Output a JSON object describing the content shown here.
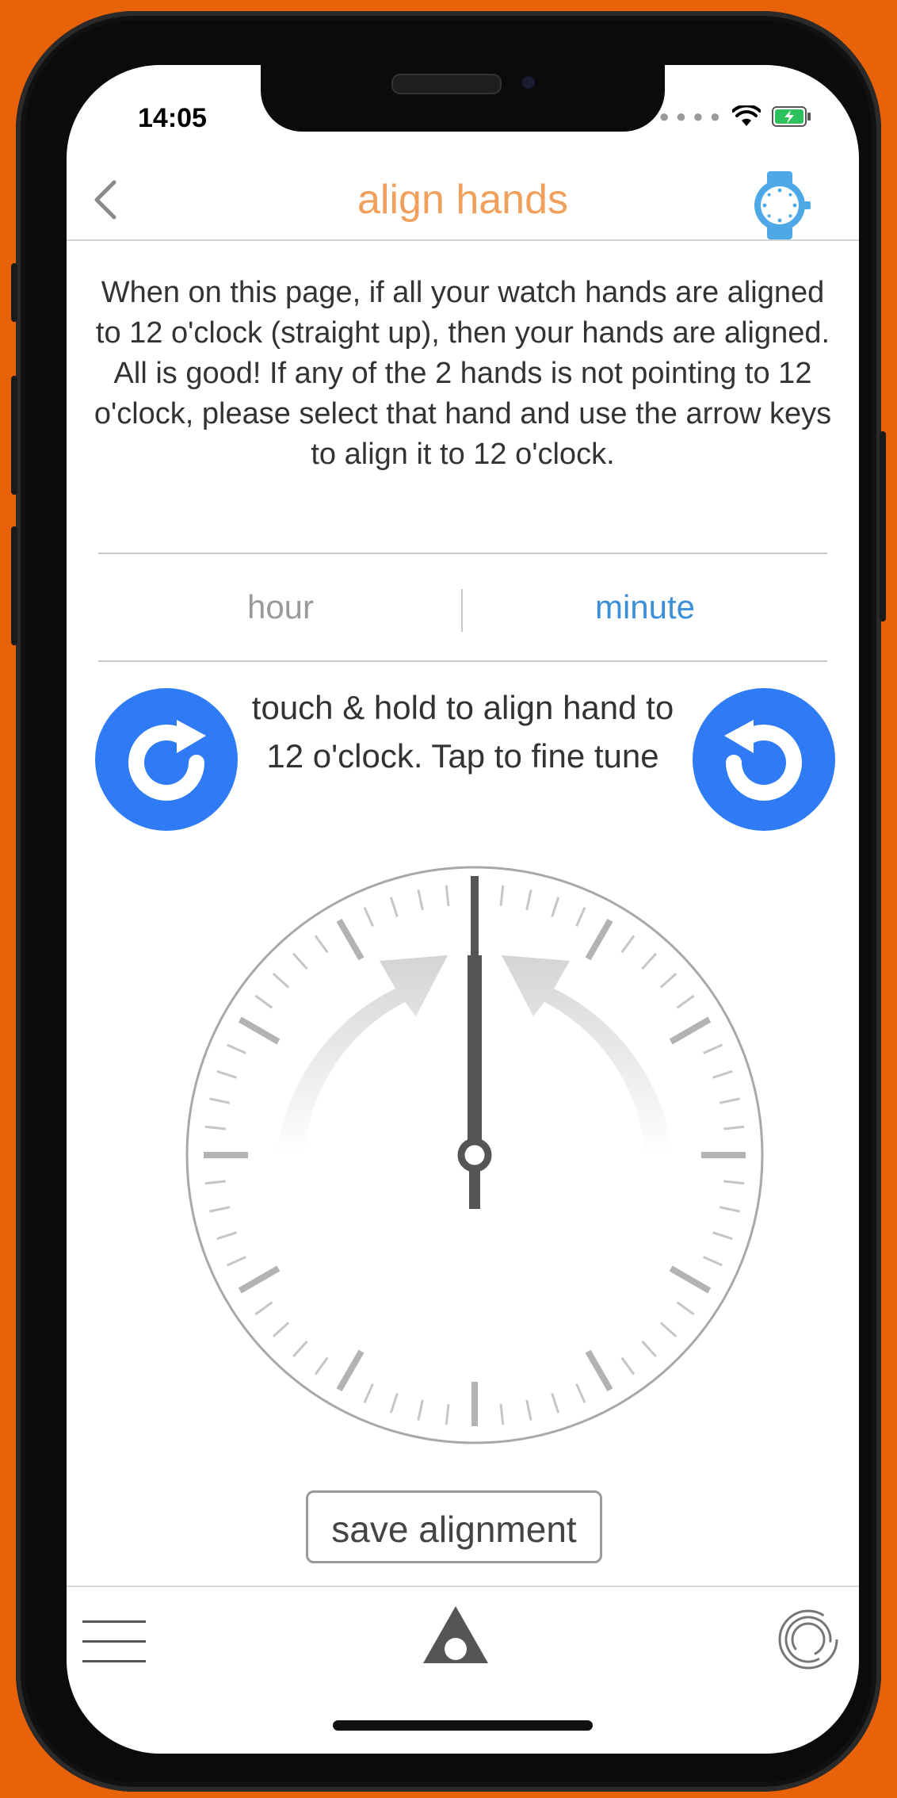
{
  "status_bar": {
    "time": "14:05",
    "signal_icon": "signal-dots-icon",
    "wifi_icon": "wifi-icon",
    "battery_icon": "battery-charging-icon"
  },
  "nav": {
    "title": "align hands",
    "back_icon": "chevron-left-icon",
    "watch_icon": "watch-icon"
  },
  "instructions": "When on this page, if all your watch hands are aligned to 12 o'clock (straight up), then your hands are aligned. All is good! If any of the 2 hands is not pointing to 12 o'clock, please select that hand and use the arrow keys to align it to 12 o'clock.",
  "segmented": {
    "options": [
      "hour",
      "minute"
    ],
    "selected": "minute"
  },
  "hint": "touch & hold to align hand to 12 o'clock. Tap to fine tune",
  "rotate_buttons": {
    "left_icon": "rotate-clockwise-icon",
    "right_icon": "rotate-counterclockwise-icon"
  },
  "save_button": "save alignment",
  "tabbar": {
    "menu_icon": "hamburger-menu-icon",
    "home_icon": "triangle-logo-icon",
    "sync_icon": "sync-rings-icon"
  },
  "colors": {
    "background": "#e8620a",
    "title": "#f0a05a",
    "selected_segment": "#3b8fd9",
    "rotate_button": "#2f7af5",
    "watch_icon": "#4ca9e6"
  }
}
